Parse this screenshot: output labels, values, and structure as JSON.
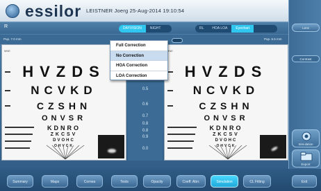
{
  "header": {
    "logo_text": "essilor",
    "session_info": "LEISTNER Joerg  25-Aug-2014  19:10:54"
  },
  "top": {
    "rl_indicator": "R",
    "mode_toggle": [
      "DAYVISION",
      "NIGHT"
    ],
    "view_toggle": [
      "RL",
      "HOA LOA",
      "Eyechart"
    ],
    "pupil_left": "Pup. 7.0 mm",
    "pupil_right": "Pup. 6.5 mm"
  },
  "dropdown": {
    "options": [
      "Full Correction",
      "No Correction",
      "HOA Correction",
      "LOA Correction"
    ],
    "selected": "No Correction"
  },
  "chart": {
    "rows": [
      "HVZDS",
      "NCVKD",
      "CZSHN",
      "ONVSR",
      "KDNRO",
      "ZKCSV",
      "DVOHC",
      "OHVCK"
    ],
    "small_label": "MNE"
  },
  "acuity": [
    "0.5",
    "0.6",
    "0.7",
    "0.8",
    "0.8",
    "0.9",
    "0.0"
  ],
  "right_panel": {
    "top_label": "Lens",
    "mid_label": "Contrast",
    "btn1_label": "Simulation",
    "btn2_label": "Export"
  },
  "bottom_nav": [
    "Summary",
    "Maps",
    "Cornea",
    "Tests",
    "Opacity",
    "Coeff. Abrr.",
    "Simulation",
    "CL Fitting",
    "Exit"
  ],
  "bottom_active": "Simulation"
}
